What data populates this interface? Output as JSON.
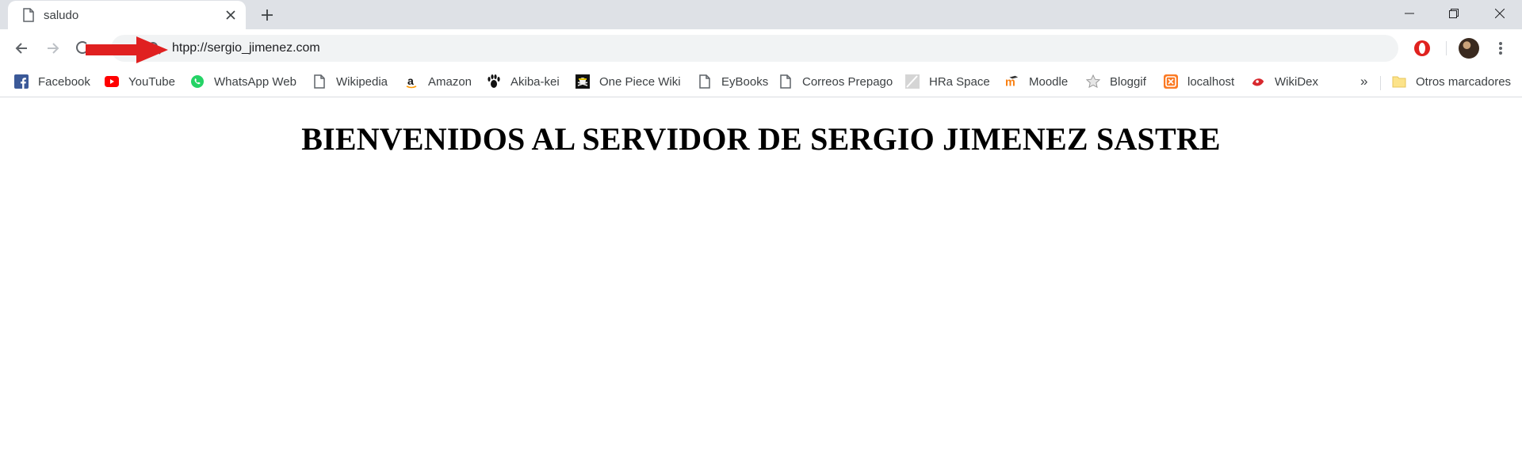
{
  "browser": {
    "tab": {
      "title": "saludo",
      "close_glyph": "✕"
    },
    "new_tab_glyph": "+",
    "window_controls": {
      "minimize": "—",
      "maximize": "❐",
      "close": "✕"
    },
    "omnibox": {
      "url": "htpp://sergio_jimenez.com"
    },
    "bookmarks": [
      {
        "label": "Facebook",
        "icon": "facebook-icon"
      },
      {
        "label": "YouTube",
        "icon": "youtube-icon"
      },
      {
        "label": "WhatsApp Web",
        "icon": "whatsapp-icon"
      },
      {
        "label": "Wikipedia",
        "icon": "page-icon"
      },
      {
        "label": "Amazon",
        "icon": "amazon-icon"
      },
      {
        "label": "Akiba-kei",
        "icon": "paw-icon"
      },
      {
        "label": "One Piece Wiki",
        "icon": "one-piece-icon"
      },
      {
        "label": "EyBooks",
        "icon": "page-icon"
      },
      {
        "label": "Correos Prepago",
        "icon": "page-icon"
      },
      {
        "label": "HRa Space",
        "icon": "hra-icon"
      },
      {
        "label": "Moodle",
        "icon": "moodle-icon"
      },
      {
        "label": "Bloggif",
        "icon": "star-icon"
      },
      {
        "label": "localhost",
        "icon": "xampp-icon"
      },
      {
        "label": "WikiDex",
        "icon": "wikidex-icon"
      }
    ],
    "bookmarks_overflow": "»",
    "other_bookmarks": {
      "label": "Otros marcadores",
      "icon": "folder-icon"
    }
  },
  "page": {
    "heading": "BIENVENIDOS AL SERVIDOR DE SERGIO JIMENEZ SASTRE"
  },
  "colors": {
    "tabstrip": "#dee1e6",
    "omnibox": "#f1f3f4",
    "annotation_arrow": "#e02020"
  }
}
